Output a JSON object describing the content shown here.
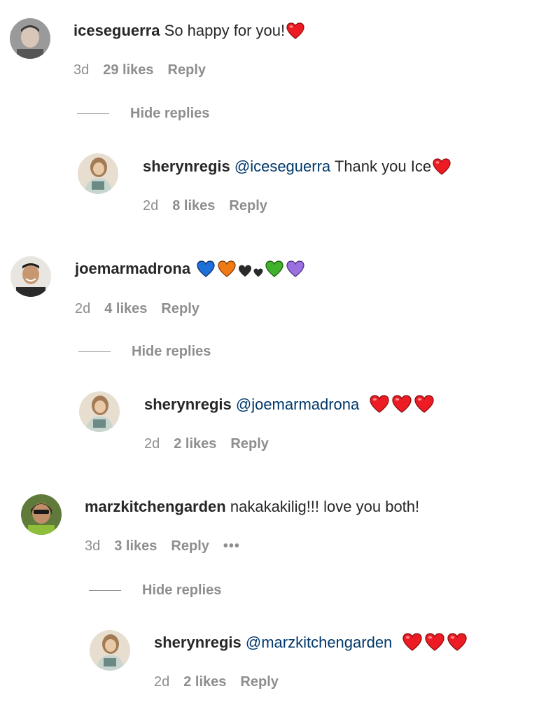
{
  "comments": [
    {
      "username": "iceseguerra",
      "text": "So happy for you!",
      "emoji": [
        "red-heart"
      ],
      "time": "3d",
      "likes": "29 likes",
      "reply_label": "Reply",
      "hide_replies_label": "Hide replies",
      "reply": {
        "username": "sherynregis",
        "mention": "@iceseguerra",
        "text": "Thank you Ice",
        "emoji": [
          "red-heart"
        ],
        "time": "2d",
        "likes": "8 likes",
        "reply_label": "Reply"
      }
    },
    {
      "username": "joemarmadrona",
      "text": "",
      "emoji": [
        "blue-heart",
        "orange-heart",
        "black-heart",
        "small-black-heart",
        "green-heart",
        "purple-heart"
      ],
      "time": "2d",
      "likes": "4 likes",
      "reply_label": "Reply",
      "hide_replies_label": "Hide replies",
      "reply": {
        "username": "sherynregis",
        "mention": "@joemarmadrona",
        "text": "",
        "emoji": [
          "red-heart",
          "red-heart",
          "red-heart"
        ],
        "time": "2d",
        "likes": "2 likes",
        "reply_label": "Reply"
      }
    },
    {
      "username": "marzkitchengarden",
      "text": "nakakakilig!!! love you both!",
      "emoji": [],
      "time": "3d",
      "likes": "3 likes",
      "reply_label": "Reply",
      "more_label": "•••",
      "hide_replies_label": "Hide replies",
      "reply": {
        "username": "sherynregis",
        "mention": "@marzkitchengarden",
        "text": "",
        "emoji": [
          "red-heart",
          "red-heart",
          "red-heart"
        ],
        "time": "2d",
        "likes": "2 likes",
        "reply_label": "Reply"
      }
    }
  ],
  "colors": {
    "red": "#ed1c24",
    "blue": "#1f6fd8",
    "orange": "#f07a14",
    "black": "#2a2a2a",
    "green": "#3fb12a",
    "purple": "#9a6fe0",
    "text": "#262626",
    "muted": "#8e8e8e",
    "mention": "#00376b"
  }
}
